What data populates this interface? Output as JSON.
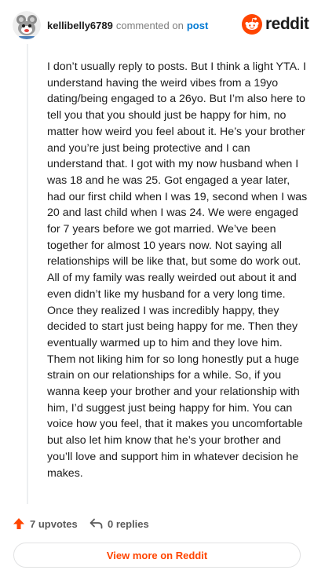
{
  "header": {
    "username": "kellibelly6789",
    "verb": "commented on",
    "target": "post",
    "brand": "reddit"
  },
  "comment": {
    "body": "I don’t usually reply to posts. But I think a light YTA. I understand having the weird vibes from a 19yo dating/being engaged to a 26yo. But I’m also here to tell you that you should just be happy for him, no matter how weird you feel about it. He’s your brother and you’re just being protective and I can understand that. I got with my now husband when I was 18 and he was 25. Got engaged a year later, had our first child when I was 19, second when I was 20 and last child when I was 24. We were engaged for 7 years before we got married. We’ve been together for almost 10 years now. Not saying all relationships will be like that, but some do work out. All of my family was really weirded out about it and even didn’t like my husband for a very long time. Once they realized I was incredibly happy, they decided to start just being happy for me. Then they eventually warmed up to him and they love him. Them not liking him for so long honestly put a huge strain on our relationships for a while. So, if you wanna keep your brother and your relationship with him, I’d suggest just being happy for him. You can voice how you feel, that it makes you uncomfortable but also let him know that he’s your brother and you’ll love and support him in whatever decision he makes."
  },
  "actions": {
    "upvotes": "7 upvotes",
    "replies": "0 replies"
  },
  "footer": {
    "view_more": "View more on Reddit"
  },
  "colors": {
    "accent": "#ff4500",
    "link": "#0079d3",
    "text": "#1c1c1c",
    "muted": "#7c7c7c"
  }
}
